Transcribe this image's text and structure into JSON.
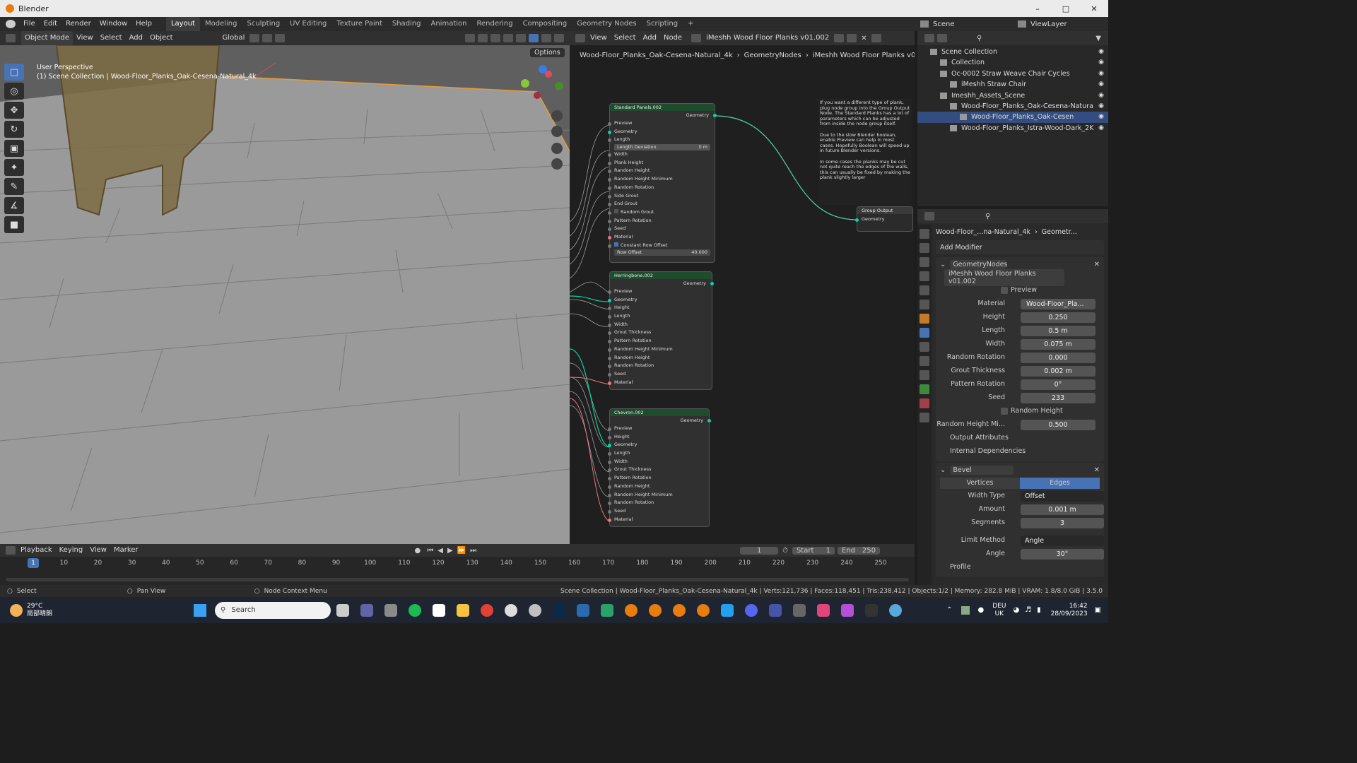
{
  "window": {
    "title": "Blender"
  },
  "menu": [
    "File",
    "Edit",
    "Render",
    "Window",
    "Help"
  ],
  "workspaces": [
    "Layout",
    "Modeling",
    "Sculpting",
    "UV Editing",
    "Texture Paint",
    "Shading",
    "Animation",
    "Rendering",
    "Compositing",
    "Geometry Nodes",
    "Scripting"
  ],
  "active_workspace": "Layout",
  "scene": {
    "label": "Scene",
    "viewlayer": "ViewLayer"
  },
  "viewport": {
    "mode": "Object Mode",
    "menus": [
      "View",
      "Select",
      "Add",
      "Object"
    ],
    "orientation": "Global",
    "options": "Options",
    "info_line1": "User Perspective",
    "info_line2": "(1) Scene Collection | Wood-Floor_Planks_Oak-Cesena-Natural_4k"
  },
  "node_editor": {
    "menus": [
      "View",
      "Select",
      "Add",
      "Node"
    ],
    "tree_name": "iMeshh Wood Floor Planks v01.002",
    "breadcrumb": [
      "Wood-Floor_Planks_Oak-Cesena-Natural_4k",
      "GeometryNodes",
      "iMeshh Wood Floor Planks v01.002"
    ],
    "note": "If you want a different type of plank, plug node group into the Group Output Node. The Standard Planks has a lot of parameters which can be adjusted from inside the node group itself.\n\nDue to the slow Blender boolean, enable Preview can help in most cases. Hopefully Boolean will speed up in future Blender versions.\n\nIn some cases the planks may be cut not quite reach the edges of the walls, this can usually be fixed by making the plank slightly larger",
    "group_output": {
      "title": "Group Output",
      "socket": "Geometry"
    },
    "nodes": {
      "standard": {
        "title": "Standard Panels.002",
        "output": "Geometry",
        "inputs": [
          "Preview",
          "Geometry",
          "Length"
        ],
        "length_dev_label": "Length Deviation",
        "length_dev_value": "0 m",
        "inputs2": [
          "Width",
          "Plank Height",
          "Random Height",
          "Random Height Minimum",
          "Random Rotation",
          "Side Grout",
          "End Grout"
        ],
        "random_grout": "Random Grout",
        "inputs3": [
          "Pattern Rotation",
          "Seed",
          "Material"
        ],
        "constant_row": "Constant Row Offset",
        "row_offset_label": "Row Offset",
        "row_offset_value": "40.000"
      },
      "herringbone": {
        "title": "Herringbone.002",
        "output": "Geometry",
        "inputs": [
          "Preview",
          "Geometry",
          "Height",
          "Length",
          "Width",
          "Grout Thickness",
          "Pattern Rotation",
          "Random Height Minimum",
          "Random Height",
          "Random Rotation",
          "Seed",
          "Material"
        ]
      },
      "chevron": {
        "title": "Chevron.002",
        "output": "Geometry",
        "inputs": [
          "Preview",
          "Height",
          "Geometry",
          "Length",
          "Width",
          "Grout Thickness",
          "Pattern Rotation",
          "Random Height",
          "Random Height Minimum",
          "Random Rotation",
          "Seed",
          "Material"
        ]
      }
    }
  },
  "outliner": {
    "items": [
      {
        "label": "Scene Collection",
        "indent": 0
      },
      {
        "label": "Collection",
        "indent": 1
      },
      {
        "label": "Oc-0002 Straw Weave Chair Cycles",
        "indent": 1
      },
      {
        "label": "iMeshh Straw Chair",
        "indent": 2
      },
      {
        "label": "Imeshh_Assets_Scene",
        "indent": 1
      },
      {
        "label": "Wood-Floor_Planks_Oak-Cesena-Natura",
        "indent": 2
      },
      {
        "label": "Wood-Floor_Planks_Oak-Cesen",
        "indent": 3
      },
      {
        "label": "Wood-Floor_Planks_Istra-Wood-Dark_2K",
        "indent": 2
      }
    ],
    "selected_index": 6
  },
  "properties": {
    "breadcrumb": [
      "Wood-Floor_...na-Natural_4k",
      "Geometr..."
    ],
    "add_modifier": "Add Modifier",
    "modifier_name": "GeometryNodes",
    "node_group": "iMeshh Wood Floor Planks v01.002",
    "preview": "Preview",
    "material_label": "Material",
    "material_value": "Wood-Floor_Pla...",
    "fields": [
      {
        "label": "Height",
        "value": "0.250"
      },
      {
        "label": "Length",
        "value": "0.5 m"
      },
      {
        "label": "Width",
        "value": "0.075 m"
      },
      {
        "label": "Random Rotation",
        "value": "0.000"
      },
      {
        "label": "Grout Thickness",
        "value": "0.002 m"
      },
      {
        "label": "Pattern Rotation",
        "value": "0°"
      },
      {
        "label": "Seed",
        "value": "233"
      }
    ],
    "random_height": "Random Height",
    "random_height_min_label": "Random Height Mi...",
    "random_height_min_value": "0.500",
    "output_attrs": "Output Attributes",
    "internal_deps": "Internal Dependencies",
    "bevel": {
      "name": "Bevel",
      "vertices": "Vertices",
      "edges": "Edges",
      "width_type_label": "Width Type",
      "width_type": "Offset",
      "amount_label": "Amount",
      "amount": "0.001 m",
      "segments_label": "Segments",
      "segments": "3",
      "limit_label": "Limit Method",
      "limit": "Angle",
      "angle_label": "Angle",
      "angle": "30°",
      "profile": "Profile"
    }
  },
  "timeline": {
    "menus": [
      "Playback",
      "Keying",
      "View",
      "Marker"
    ],
    "current": "1",
    "start_label": "Start",
    "start": "1",
    "end_label": "End",
    "end": "250",
    "ticks": [
      "1",
      "10",
      "20",
      "30",
      "40",
      "50",
      "60",
      "70",
      "80",
      "90",
      "100",
      "110",
      "120",
      "130",
      "140",
      "150",
      "160",
      "170",
      "180",
      "190",
      "200",
      "210",
      "220",
      "230",
      "240",
      "250"
    ]
  },
  "status": {
    "select": "Select",
    "pan": "Pan View",
    "context": "Node Context Menu",
    "stats": "Scene Collection | Wood-Floor_Planks_Oak-Cesena-Natural_4k | Verts:121,736 | Faces:118,451 | Tris:238,412 | Objects:1/2 | Memory: 282.8 MiB | VRAM: 1.8/8.0 GiB | 3.5.0"
  },
  "taskbar": {
    "temp": "29°C",
    "weather": "局部晴朗",
    "search": "Search",
    "lang1": "DEU",
    "lang2": "UK",
    "time": "16:42",
    "date": "28/09/2023"
  }
}
